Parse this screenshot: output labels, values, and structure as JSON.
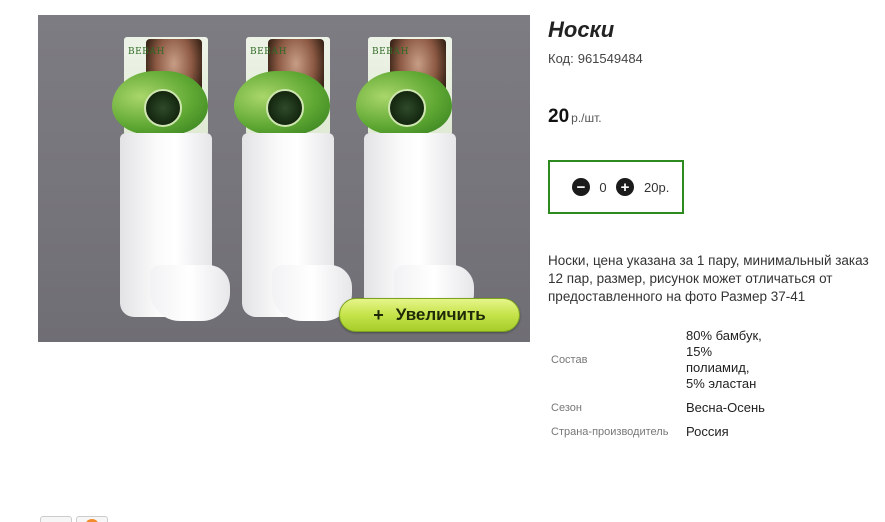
{
  "product": {
    "title": "Носки",
    "sku_label": "Код:",
    "sku": "961549484",
    "price": "20",
    "price_unit": "р./шт.",
    "quantity": "0",
    "sum": "20р.",
    "description": "Носки, цена указана за 1 пару, минимальный заказ 12 пар, размер, рисунок может отличаться от предоставленного на фото Размер 37-41"
  },
  "image": {
    "zoom_plus": "+",
    "zoom_label": "Увеличить",
    "pack_brand": "ВЕВАН"
  },
  "controls": {
    "minus": "−",
    "plus": "+"
  },
  "properties": [
    {
      "key": "Состав",
      "value": "80% бамбук, 15% полиамид, 5% эластан"
    },
    {
      "key": "Сезон",
      "value": "Весна-Осень"
    },
    {
      "key": "Страна-производитель",
      "value": "Россия"
    }
  ],
  "colors": {
    "accent_border": "#2d8a1f",
    "zoom_button": "#c5e34a",
    "photo_bg": "#76757b"
  }
}
